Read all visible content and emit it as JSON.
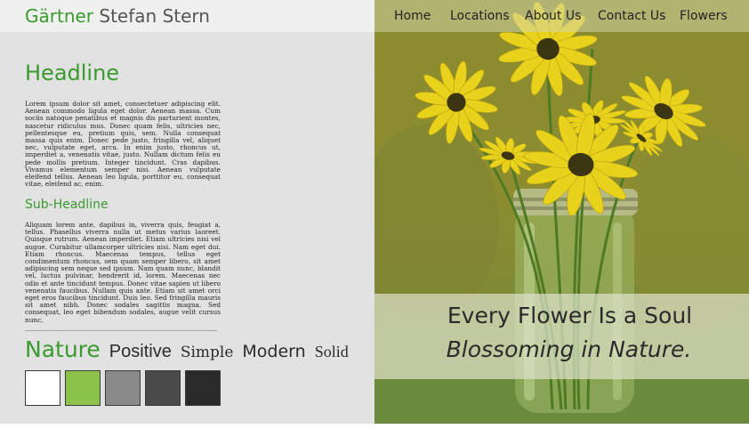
{
  "brand": {
    "first": "Gärtner",
    "second": "Stefan Stern"
  },
  "nav": {
    "items": [
      {
        "label": "Home"
      },
      {
        "label": "Locations"
      },
      {
        "label": "About Us"
      },
      {
        "label": "Contact Us"
      },
      {
        "label": "Flowers"
      }
    ]
  },
  "content": {
    "headline": "Headline",
    "paragraph1": "Lorem ipsum dolor sit amet, consectetuer adipiscing elit. Aenean commodo ligula eget dolor. Aenean massa. Cum sociis natoque penatibus et magnis dis parturient montes, nascetur ridiculus mus. Donec quam felis, ultricies nec, pellentesque eu, pretium quis, sem. Nulla consequat massa quis enim. Donec pede justo, fringilla vel, aliquet nec, vulputate eget, arcu. In enim justo, rhoncus ut, imperdiet a, venenatis vitae, justo. Nullam dictum felis eu pede mollis pretium. Integer tincidunt. Cras dapibus. Vivamus elementum semper nisi. Aenean vulputate eleifend tellus. Aenean leo ligula, porttitor eu, consequat vitae, eleifend ac, enim.",
    "subheadline": "Sub-Headline",
    "paragraph2": "Aliquam lorem ante, dapibus in, viverra quis, feugiat a, tellus. Phasellus viverra nulla ut metus varius laoreet. Quisque rutrum. Aenean imperdiet. Etiam ultricies nisi vel augue. Curabitur ullamcorper ultricies nisi. Nam eget dui. Etiam rhoncus. Maecenas tempus, tellus eget condimentum rhoncus, sem quam semper libero, sit amet adipiscing sem neque sed ipsum. Nam quam nunc, blandit vel, luctus pulvinar, hendrerit id, lorem. Maecenas nec odio et ante tincidunt tempus. Donec vitae sapien ut libero venenatis faucibus. Nullam quis ante. Etiam sit amet orci eget eros faucibus tincidunt. Duis leo. Sed fringilla mauris sit amet nibh. Donec sodales sagittis magna. Sed consequat, leo eget bibendum sodales, augue velit cursus nunc,"
  },
  "style_guide": {
    "font_samples": [
      "Nature",
      "Positive",
      "Simple",
      "Modern",
      "Solid"
    ],
    "swatch_colors": [
      "#ffffff",
      "#8bc34a",
      "#8a8a8a",
      "#4a4a4a",
      "#2a2a2a"
    ]
  },
  "hero": {
    "tagline_line1": "Every Flower Is a Soul",
    "tagline_line2": "Blossoming in Nature."
  },
  "colors": {
    "accent": "#3a9a2e",
    "flower_petal": "#e8d21c",
    "flower_center": "#3b3512"
  }
}
